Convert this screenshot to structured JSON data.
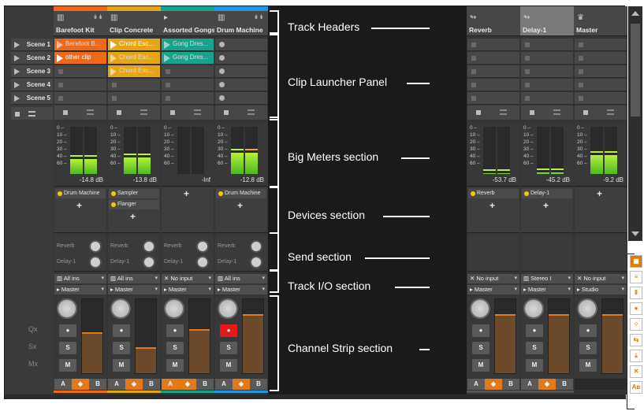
{
  "scenes": [
    "Scene 1",
    "Scene 2",
    "Scene 3",
    "Scene 4",
    "Scene 5"
  ],
  "side_labels": [
    "Q",
    "S",
    "M"
  ],
  "tracks": [
    {
      "name": "Barefoot Kit",
      "color": "#ee6a1b",
      "icon": "piano-icon",
      "clips": [
        {
          "label": "Barefoot B...",
          "color": "#ee6a1b",
          "state": "play"
        },
        {
          "label": "other clip",
          "color": "#ee6a1b",
          "state": "playing"
        },
        {
          "label": "",
          "state": "empty"
        },
        {
          "label": "",
          "state": "empty"
        },
        {
          "label": "",
          "state": "empty"
        }
      ],
      "meter_db": "-14.8 dB",
      "meter_level": 0.32,
      "devices": [
        "Drum Machine"
      ],
      "sends": [
        "Reverb",
        "Delay-1"
      ],
      "input": "All ins",
      "output": "Master",
      "fader": 0.55,
      "color_bar": "#ee6a1b"
    },
    {
      "name": "Clip Concrete",
      "color": "#e6a516",
      "icon": "piano-icon",
      "clips": [
        {
          "label": "Chord Esc...",
          "color": "#e6a516",
          "state": "playing"
        },
        {
          "label": "Chord Esc...",
          "color": "#e6a516",
          "state": "play"
        },
        {
          "label": "Chord Esc...",
          "color": "#e6a516",
          "state": "play"
        },
        {
          "label": "",
          "state": "empty"
        },
        {
          "label": "",
          "state": "empty"
        }
      ],
      "meter_db": "-13.8 dB",
      "meter_level": 0.35,
      "devices": [
        "Sampler",
        "Flanger"
      ],
      "sends": [
        "Reverb",
        "Delay-1"
      ],
      "input": "All ins",
      "output": "Master",
      "fader": 0.35,
      "color_bar": "#e6a516"
    },
    {
      "name": "Assorted Gongs",
      "color": "#17a38c",
      "icon": "audio-icon",
      "clips": [
        {
          "label": "Gong Dres...",
          "color": "#17a38c",
          "state": "play"
        },
        {
          "label": "Gong Dres...",
          "color": "#17a38c",
          "state": "play"
        },
        {
          "label": "",
          "state": "empty"
        },
        {
          "label": "",
          "state": "empty"
        },
        {
          "label": "",
          "state": "empty"
        }
      ],
      "meter_db": "-Inf",
      "meter_level": 0,
      "devices": [],
      "sends": [
        "Reverb",
        "Delay-1"
      ],
      "input": "No input",
      "output": "Master",
      "fader": 0.6,
      "color_bar": "#17a38c"
    },
    {
      "name": "Drum Machine",
      "color": "#1e96e4",
      "icon": "piano-icon",
      "clips": [
        {
          "label": "",
          "state": "dot"
        },
        {
          "label": "",
          "state": "dot"
        },
        {
          "label": "",
          "state": "dot"
        },
        {
          "label": "",
          "state": "dot"
        },
        {
          "label": "",
          "state": "dot"
        }
      ],
      "meter_db": "-12.8 dB",
      "meter_level": 0.45,
      "devices": [
        "Drum Machine"
      ],
      "sends": [
        "Reverb",
        "Delay-1"
      ],
      "input": "All ins",
      "output": "Master",
      "fader": 0.8,
      "color_bar": "#1e96e4"
    }
  ],
  "fx_tracks": [
    {
      "name": "Reverb",
      "meter_db": "-53.7 dB",
      "meter_level": 0.02,
      "devices": [
        "Reverb"
      ],
      "input": "No input",
      "output": "Master",
      "fader": 0.8
    },
    {
      "name": "Delay-1",
      "meter_db": "-45.2 dB",
      "meter_level": 0.04,
      "devices": [
        "Delay-1"
      ],
      "input": "Stereo I",
      "output": "Master",
      "fader": 0.8
    },
    {
      "name": "Master",
      "meter_db": "-9.2 dB",
      "meter_level": 0.4,
      "devices": [],
      "input": "No input",
      "output": "Studio",
      "fader": 0.8
    }
  ],
  "meter_scale": [
    "0",
    "10",
    "20",
    "30",
    "40",
    "60"
  ],
  "buttons": {
    "record": "●",
    "solo": "S",
    "mute": "M",
    "a": "A",
    "b": "B"
  },
  "callouts": {
    "track_headers": "Track Headers",
    "clip_launcher": "Clip Launcher Panel",
    "big_meters": "Big Meters section",
    "devices": "Devices section",
    "send": "Send section",
    "track_io": "Track I/O section",
    "channel_strip": "Channel Strip section"
  }
}
